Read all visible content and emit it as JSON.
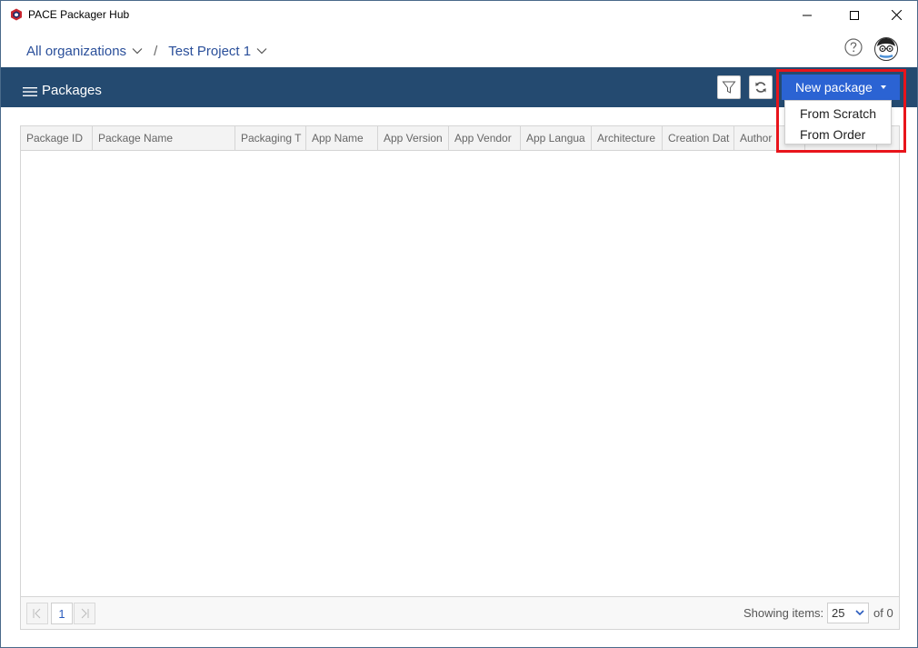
{
  "window": {
    "title": "PACE Packager Hub",
    "controls": [
      "minimize-icon",
      "maximize-icon",
      "close-icon"
    ]
  },
  "breadcrumb": {
    "organization": "All organizations",
    "separator": "/",
    "project": "Test Project 1"
  },
  "header": {
    "title": "Packages",
    "new_package_label": "New package",
    "tools": [
      "filter-icon",
      "refresh-icon"
    ]
  },
  "new_package_menu": {
    "items": [
      "From Scratch",
      "From Order"
    ]
  },
  "grid": {
    "columns": [
      {
        "label": "Package ID"
      },
      {
        "label": "Package Name"
      },
      {
        "label": "Packaging T"
      },
      {
        "label": "App Name"
      },
      {
        "label": "App Version"
      },
      {
        "label": "App Vendor"
      },
      {
        "label": "App Langua"
      },
      {
        "label": "Architecture"
      },
      {
        "label": "Creation Dat"
      },
      {
        "label": "Author"
      },
      {
        "label": ""
      },
      {
        "label": ""
      }
    ],
    "rows": []
  },
  "pager": {
    "current_page": "1",
    "showing_label": "Showing items:",
    "page_size": "25",
    "of_total": "of 0"
  },
  "colors": {
    "header_bar": "#244a70",
    "primary_button": "#2b63d3",
    "link_text": "#2a4f9a",
    "highlight": "#e8141b"
  }
}
